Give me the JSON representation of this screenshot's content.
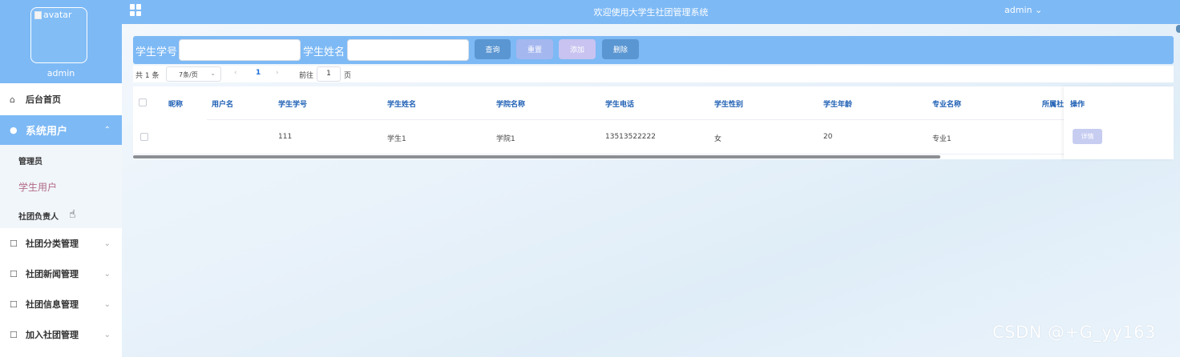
{
  "header": {
    "title": "欢迎使用大学生社团管理系统",
    "user": "admin",
    "user_caret": "⌄"
  },
  "profile": {
    "avatar_alt": "avatar",
    "name": "admin"
  },
  "sidebar": {
    "home": {
      "icon": "home-icon",
      "label": "后台首页"
    },
    "system_users": {
      "icon": "user-icon",
      "label": "系统用户",
      "expanded": true
    },
    "sub_items": [
      {
        "label": "管理员"
      },
      {
        "label": "学生用户",
        "active": true
      },
      {
        "label": "社团负责人"
      }
    ],
    "groups": [
      {
        "icon": "file-icon",
        "label": "社团分类管理"
      },
      {
        "icon": "file-icon",
        "label": "社团新闻管理"
      },
      {
        "icon": "file-icon",
        "label": "社团信息管理"
      },
      {
        "icon": "file-icon",
        "label": "加入社团管理"
      }
    ]
  },
  "search": {
    "student_no_label": "学生学号",
    "student_no_value": "",
    "student_name_label": "学生姓名",
    "student_name_value": "",
    "buttons": {
      "query": "查询",
      "reset": "重置",
      "add": "添加",
      "delete": "删除"
    }
  },
  "pagination": {
    "total": "共 1 条",
    "page_size": "7条/页",
    "prev": "‹",
    "current_page": "1",
    "next": "›",
    "goto_label": "前往",
    "goto_value": "1",
    "goto_unit": "页"
  },
  "table": {
    "columns": [
      "昵称",
      "用户名",
      "学生学号",
      "学生姓名",
      "学院名称",
      "学生电话",
      "学生性别",
      "学生年龄",
      "专业名称",
      "所属社",
      "操作"
    ],
    "rows": [
      {
        "nickname": "",
        "username": "",
        "student_no": "111",
        "student_name": "学生1",
        "college": "学院1",
        "phone": "13513522222",
        "gender": "女",
        "age": "20",
        "major": "专业1",
        "club": "",
        "action": "详情"
      }
    ]
  },
  "watermark": "CSDN @+G_yy163",
  "colors": {
    "primary": "#7db9f5",
    "button_dark": "#5a96d2",
    "active_link": "#b26a88",
    "header_text": "#1d5fb4"
  }
}
